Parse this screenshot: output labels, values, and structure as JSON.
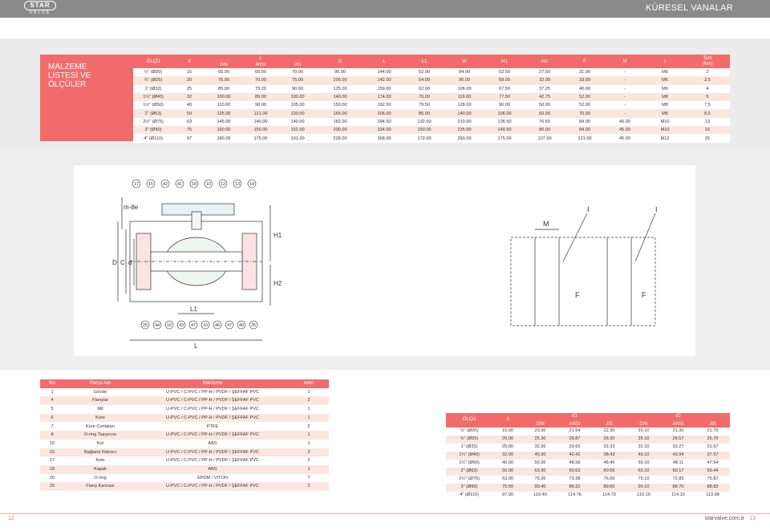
{
  "brand": {
    "logo_main": "STAR",
    "logo_sub": "VALVE"
  },
  "header": {
    "title": "KÜRESEL VANALAR"
  },
  "side": {
    "lines": [
      "MALZEME",
      "LİSTESİ VE",
      "ÖLÇÜLER"
    ]
  },
  "dims_table": {
    "headers": {
      "olcu": "ÖLÇÜ",
      "d": "d",
      "L_group": "L",
      "din": "DIN",
      "ansi": "ANSI",
      "jis": "JIS",
      "D": "D",
      "L": "L",
      "L1": "L1",
      "W": "W",
      "H1": "H1",
      "H2": "H2",
      "F": "F",
      "M": "M",
      "I": "I",
      "tork": "Tork\n(Nm)"
    },
    "rows": [
      [
        "½\" (Ø20)",
        "15",
        "65.00",
        "60.50",
        "70.00",
        "95.00",
        "144.00",
        "52.00",
        "84.00",
        "52.50",
        "27.50",
        "31.00",
        "-",
        "M6",
        "2"
      ],
      [
        "¾\" (Ø25)",
        "20",
        "75.00",
        "70.00",
        "75.00",
        "105.00",
        "142.00",
        "54.00",
        "90.00",
        "59.00",
        "32.00",
        "33.00",
        "-",
        "M6",
        "2.5"
      ],
      [
        "1\" (Ø32)",
        "25",
        "85.00",
        "79.20",
        "90.00",
        "125.00",
        "159.00",
        "62.00",
        "106.00",
        "67.50",
        "37.25",
        "40.00",
        "-",
        "M6",
        "4"
      ],
      [
        "1¼\" (Ø40)",
        "32",
        "100.00",
        "89.00",
        "100.00",
        "140.00",
        "174.00",
        "70.00",
        "116.00",
        "77.50",
        "42.75",
        "52.00",
        "-",
        "M8",
        "5"
      ],
      [
        "1½\" (Ø50)",
        "40",
        "110.00",
        "98.00",
        "105.00",
        "150.00",
        "192.50",
        "79.50",
        "128.00",
        "90.00",
        "50.00",
        "52.00",
        "-",
        "M8",
        "7.5"
      ],
      [
        "2\" (Ø63)",
        "50",
        "125.00",
        "121.00",
        "120.00",
        "165.00",
        "206.00",
        "85.00",
        "140.00",
        "106.00",
        "60.00",
        "70.00",
        "-",
        "M8",
        "8.5"
      ],
      [
        "2½\" (Ø75)",
        "63",
        "145.00",
        "140.00",
        "140.00",
        "182.00",
        "294.50",
        "132.50",
        "210.00",
        "136.50",
        "76.50",
        "84.00",
        "45.00",
        "M10",
        "13"
      ],
      [
        "3\" (Ø90)",
        "75",
        "160.00",
        "150.00",
        "152.00",
        "200.00",
        "324.00",
        "150.00",
        "235.00",
        "149.50",
        "86.00",
        "84.00",
        "45.00",
        "M10",
        "16"
      ],
      [
        "4\" (Ø110)",
        "97",
        "180.00",
        "175.00",
        "191.00",
        "228.00",
        "368.00",
        "172.00",
        "260.00",
        "175.00",
        "107.00",
        "121.00",
        "45.00",
        "M12",
        "25"
      ]
    ]
  },
  "drawing": {
    "dim_labels": {
      "m8e": "m-8e",
      "H1": "H1",
      "H2": "H2",
      "D": "D",
      "C": "C",
      "d": "d",
      "L1": "L1",
      "L": "L",
      "M": "M",
      "I": "I",
      "F": "F"
    },
    "top_callouts": [
      "17",
      "15",
      "42",
      "41",
      "18",
      "10",
      "12",
      "13",
      "14"
    ],
    "bottom_callouts": [
      "25",
      "44",
      "16",
      "43",
      "47",
      "10",
      "46",
      "47",
      "40",
      "25"
    ]
  },
  "parts_table": {
    "headers": {
      "no": "No",
      "name": "Parça Adı",
      "material": "Malzeme",
      "qty": "Adet"
    },
    "rows": [
      [
        "1",
        "Gövde",
        "U-PVC / C-PVC / PP-H / PVDF / ŞEFFAF PVC",
        "1"
      ],
      [
        "4",
        "Flanşlar",
        "U-PVC / C-PVC / PP-H / PVDF / ŞEFFAF PVC",
        "2"
      ],
      [
        "5",
        "Mil",
        "U-PVC / C-PVC / PP-H / PVDF / ŞEFFAF PVC",
        "1"
      ],
      [
        "6",
        "Küre",
        "U-PVC / C-PVC / PP-H / PVDF / ŞEFFAF PVC",
        "1"
      ],
      [
        "7",
        "Küre Contaları",
        "PTFE",
        "2"
      ],
      [
        "8",
        "O-ring Taşıyıcısı",
        "U-PVC / C-PVC / PP-H / PVDF / ŞEFFAF PVC",
        "1"
      ],
      [
        "10",
        "Kol",
        "ABS",
        "1"
      ],
      [
        "15",
        "Bağlantı Rakoru",
        "U-PVC / C-PVC / PP-H / PVDF / ŞEFFAF PVC",
        "2"
      ],
      [
        "17",
        "Kole",
        "U-PVC / C-PVC / PP-H / PVDF / ŞEFFAF PVC",
        "2"
      ],
      [
        "18",
        "Kapak",
        "ABS",
        "1"
      ],
      [
        "20",
        "O-ring",
        "EPDM / VITON",
        "7"
      ],
      [
        "25",
        "Flanş Kancası",
        "U-PVC / C-PVC / PP-H / PVDF / ŞEFFAF PVC",
        "2"
      ]
    ]
  },
  "seals_table": {
    "headers": {
      "olcu": "ÖLÇÜ",
      "d": "d",
      "d1": "d1",
      "d2": "d2",
      "din": "DIN",
      "ansi": "ANSI",
      "jis": "JIS"
    },
    "rows": [
      [
        "½\" (Ø20)",
        "15.00",
        "20.30",
        "21.54",
        "22.30",
        "20.10",
        "21.30",
        "21.70"
      ],
      [
        "¾\" (Ø25)",
        "20.00",
        "25.30",
        "26.87",
        "26.30",
        "25.10",
        "26.57",
        "25.70"
      ],
      [
        "1\" (Ø32)",
        "25.00",
        "32.30",
        "33.65",
        "32.33",
        "32.10",
        "33.27",
        "31.67"
      ],
      [
        "1¼\" (Ø40)",
        "32.00",
        "40.30",
        "42.42",
        "38.43",
        "40.10",
        "42.04",
        "37.57"
      ],
      [
        "1½\" (Ø50)",
        "40.00",
        "50.30",
        "48.56",
        "48.46",
        "50.10",
        "48.11",
        "47.54"
      ],
      [
        "2\" (Ø63)",
        "50.00",
        "63.30",
        "60.63",
        "60.56",
        "63.10",
        "60.17",
        "59.44"
      ],
      [
        "2½\" (Ø75)",
        "63.00",
        "75.30",
        "73.38",
        "76.60",
        "75.10",
        "72.85",
        "75.87"
      ],
      [
        "3\" (Ø90)",
        "75.00",
        "90.40",
        "89.31",
        "89.60",
        "90.10",
        "88.70",
        "88.83"
      ],
      [
        "4\" (Ø110)",
        "97.00",
        "110.40",
        "114.76",
        "114.70",
        "110.10",
        "114.10",
        "113.98"
      ]
    ]
  },
  "footer": {
    "page_left": "12",
    "site": "starvalve.com.tr",
    "page_right": "13"
  },
  "colors": {
    "accent": "#f26b6b",
    "header": "#8a8a8a",
    "stripe": "#fde6e0",
    "panel": "#eeeeee"
  }
}
